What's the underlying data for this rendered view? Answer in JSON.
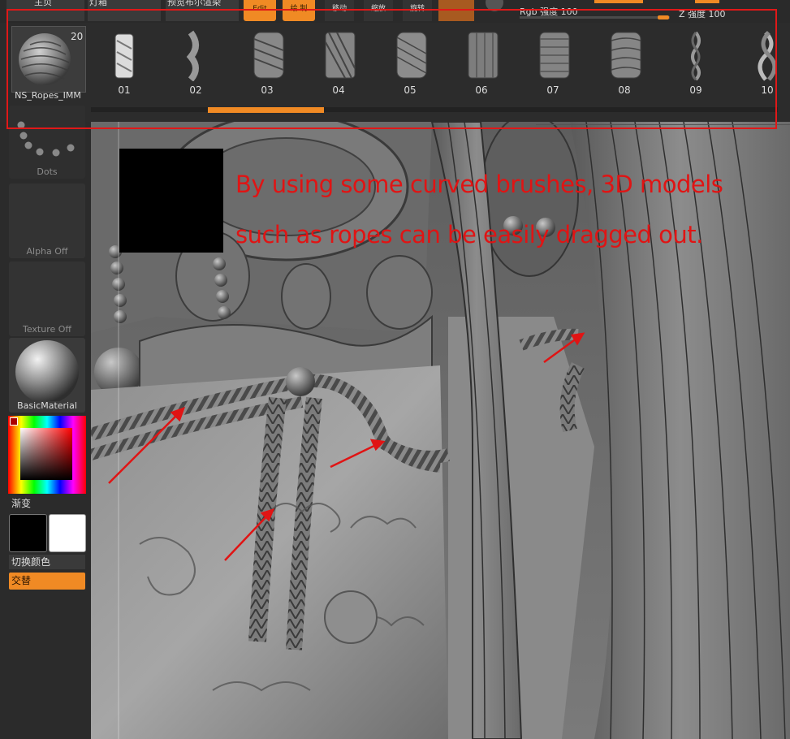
{
  "menu": {
    "items": [
      "主页",
      "灯箱",
      "预览布尔渲染"
    ],
    "edit_label": "Edit",
    "draw_label": "绘 制",
    "move_label": "移动",
    "scale_label": "缩放",
    "rotate_label": "旋转"
  },
  "sliders": {
    "rgb_label": "Rgb 强度 100",
    "z_label": "Z 强度 100",
    "rgb_intensity": 100,
    "z_intensity": 100
  },
  "brush_panel": {
    "current_brush_name": "NS_Ropes_IMM",
    "brush_count": "20",
    "brushes": [
      "01",
      "02",
      "03",
      "04",
      "05",
      "06",
      "07",
      "08",
      "09",
      "10"
    ],
    "scroll_fraction_start": 0.17,
    "scroll_fraction_end": 0.34
  },
  "left_tray": {
    "stroke_label": "Dots",
    "alpha_label": "Alpha Off",
    "texture_label": "Texture Off",
    "material_label": "BasicMaterial",
    "gradient_label": "渐变",
    "switch_color_label": "切换颜色",
    "alternate_label": "交替"
  },
  "annotation": {
    "line1": "By using some curved brushes, 3D models",
    "line2": "such as ropes can be easily dragged out.",
    "color": "#e01414"
  },
  "colors": {
    "accent": "#f08a24",
    "highlight_border": "#e01818",
    "main_color": "#000000",
    "secondary_color": "#ffffff"
  }
}
